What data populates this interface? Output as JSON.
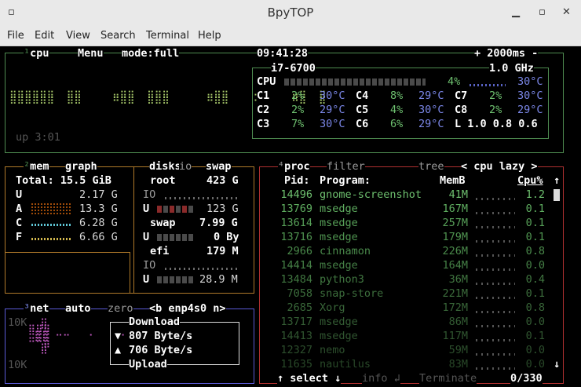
{
  "window": {
    "title": "BpyTOP"
  },
  "menu": [
    "File",
    "Edit",
    "View",
    "Search",
    "Terminal",
    "Help"
  ],
  "cpu": {
    "label_num": "¹",
    "label": "cpu",
    "menu": "Menu",
    "mode": "mode:full",
    "clock": "09:41:28",
    "interval": "+ 2000ms -",
    "model": "i7-6700",
    "freq": "1.0 GHz",
    "uptime": "up 3:01",
    "total": {
      "name": "CPU",
      "pct": "4%",
      "temp": "30°C",
      "usage": 4
    },
    "cores": [
      {
        "name": "C1",
        "pct": "2%",
        "temp": "30°C"
      },
      {
        "name": "C4",
        "pct": "8%",
        "temp": "29°C"
      },
      {
        "name": "C7",
        "pct": "2%",
        "temp": "30°C"
      },
      {
        "name": "C2",
        "pct": "2%",
        "temp": "29°C"
      },
      {
        "name": "C5",
        "pct": "4%",
        "temp": "30°C"
      },
      {
        "name": "C8",
        "pct": "2%",
        "temp": "29°C"
      },
      {
        "name": "C3",
        "pct": "7%",
        "temp": "30°C"
      },
      {
        "name": "C6",
        "pct": "6%",
        "temp": "29°C"
      }
    ],
    "load": "L 1.0 0.8 0.6"
  },
  "mem": {
    "label_num": "²",
    "label": "mem",
    "graph_label": "graph",
    "total": "Total: 15.5 GiB",
    "rows": [
      {
        "key": "U",
        "value": "2.17 G"
      },
      {
        "key": "A",
        "value": "13.3 G"
      },
      {
        "key": "C",
        "value": "6.28 G"
      },
      {
        "key": "F",
        "value": "6.66 G"
      }
    ]
  },
  "disks": {
    "label": "disks",
    "io": "io",
    "swap": "swap",
    "items": [
      {
        "name": "root",
        "size": "423 G",
        "io": "IO",
        "used_key": "U",
        "used": "123 G"
      },
      {
        "name": "swap",
        "size": "7.99 G",
        "io": "",
        "used_key": "U",
        "used": "0 By"
      },
      {
        "name": "efi",
        "size": "179 M",
        "io": "IO",
        "used_key": "U",
        "used": "28.9 M"
      }
    ]
  },
  "net": {
    "label_num": "³",
    "label": "net",
    "auto": "auto",
    "zero": "zero",
    "iface": "<b enp4s0 n>",
    "scale_top": "10K",
    "scale_bottom": "10K",
    "download_label": "Download",
    "download": "807 Byte/s",
    "upload_label": "Upload",
    "upload": "706 Byte/s",
    "down_arrow": "▼",
    "up_arrow": "▲"
  },
  "proc": {
    "label_num": "⁴",
    "label": "proc",
    "filter": "filter",
    "tree": "tree",
    "sort": "< cpu lazy >",
    "headers": {
      "pid": "Pid:",
      "program": "Program:",
      "mem": "MemB",
      "cpu": "Cpu%"
    },
    "rows": [
      {
        "pid": "14496",
        "program": "gnome-screenshot",
        "mem": "41M",
        "cpu": "1.2"
      },
      {
        "pid": "13769",
        "program": "msedge",
        "mem": "167M",
        "cpu": "0.1"
      },
      {
        "pid": "13614",
        "program": "msedge",
        "mem": "257M",
        "cpu": "0.1"
      },
      {
        "pid": "13716",
        "program": "msedge",
        "mem": "179M",
        "cpu": "0.1"
      },
      {
        "pid": "2966",
        "program": "cinnamon",
        "mem": "226M",
        "cpu": "0.8"
      },
      {
        "pid": "14414",
        "program": "msedge",
        "mem": "164M",
        "cpu": "0.0"
      },
      {
        "pid": "13484",
        "program": "python3",
        "mem": "36M",
        "cpu": "0.4"
      },
      {
        "pid": "7058",
        "program": "snap-store",
        "mem": "221M",
        "cpu": "0.1"
      },
      {
        "pid": "2685",
        "program": "Xorg",
        "mem": "172M",
        "cpu": "0.8"
      },
      {
        "pid": "13717",
        "program": "msedge",
        "mem": "86M",
        "cpu": "0.0"
      },
      {
        "pid": "14413",
        "program": "msedge",
        "mem": "117M",
        "cpu": "0.1"
      },
      {
        "pid": "12327",
        "program": "nemo",
        "mem": "59M",
        "cpu": "0.0"
      },
      {
        "pid": "11635",
        "program": "nautilus",
        "mem": "83M",
        "cpu": "0.0"
      }
    ],
    "select": "↑ select ↓",
    "info": "info ↲",
    "terminate": "Terminate",
    "count": "0/330",
    "scroll_up": "↑",
    "scroll_down": "↓"
  },
  "colors": {
    "cpu_border": "#4e8c50",
    "mem_border": "#b07a2a",
    "net_border": "#5b5bd6",
    "proc_border": "#b03030",
    "text_green": "#6ec06f",
    "temp_blue": "#7a86e6"
  }
}
